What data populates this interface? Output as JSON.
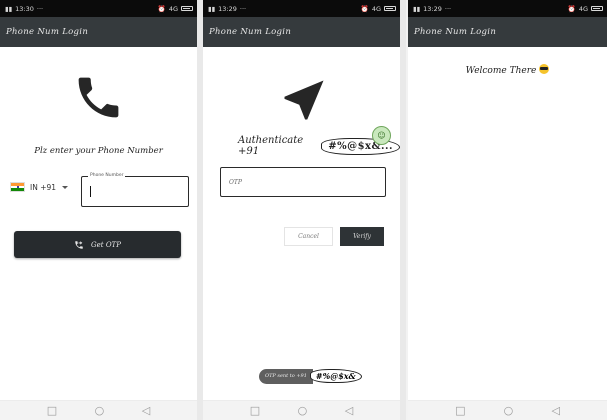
{
  "screens": [
    {
      "status": {
        "time": "13:30",
        "carrier": "4G"
      },
      "app_title": "Phone Num Login",
      "icon": "phone-icon",
      "prompt": "Plz enter your Phone Number",
      "country_code": "IN  +91",
      "phone_field": {
        "label": "Phone Number",
        "value": ""
      },
      "get_otp_label": "Get OTP"
    },
    {
      "status": {
        "time": "13:29",
        "carrier": "4G"
      },
      "app_title": "Phone Num Login",
      "icon": "navigation-arrow-icon",
      "auth_text": "Authenticate +91",
      "masked_number": "#%@$x&...",
      "otp_field": {
        "placeholder": "OTP"
      },
      "cancel_label": "Cancel",
      "verify_label": "Verify",
      "toast": {
        "text": "OTP sent to +91",
        "masked": "#%@$x&"
      }
    },
    {
      "status": {
        "time": "13:29",
        "carrier": "4G"
      },
      "app_title": "Phone Num Login",
      "welcome_text": "Welcome There"
    }
  ],
  "nav": {
    "back": "◁",
    "home": "○",
    "recents": "□"
  },
  "colors": {
    "app_bar": "#353a3d",
    "status_bar": "#0b0b0b",
    "button": "#272b2e"
  }
}
